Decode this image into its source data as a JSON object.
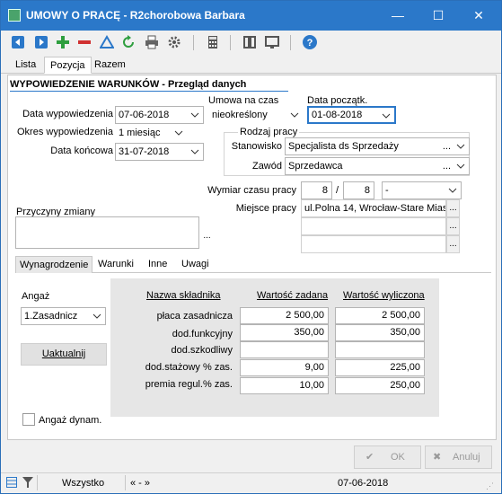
{
  "window": {
    "title": "UMOWY O PRACĘ - R2chorobowa Barbara"
  },
  "titlebar": {
    "minimize": "—",
    "maximize": "☐",
    "close": "✕"
  },
  "toolbar": {
    "icons": [
      "arrow-left-icon",
      "arrow-right-icon",
      "add-icon",
      "remove-icon",
      "filter-icon",
      "refresh-icon",
      "print-icon",
      "settings-icon",
      "calculator-icon",
      "columns-icon",
      "monitor-icon",
      "help-icon"
    ]
  },
  "tabs": [
    {
      "label": "Lista"
    },
    {
      "label": "Pozycja"
    },
    {
      "label": "Razem"
    }
  ],
  "section_title": "WYPOWIEDZENIE WARUNKÓW - Przegląd danych",
  "form": {
    "data_wypowiedzenia_label": "Data wypowiedzenia",
    "data_wypowiedzenia": "07-06-2018",
    "okres_label": "Okres wypowiedzenia",
    "okres": "1 miesiąc",
    "data_koncowa_label": "Data końcowa",
    "data_koncowa": "31-07-2018",
    "umowa_label": "Umowa na czas",
    "umowa": "nieokreślony",
    "data_poczatk_label": "Data początk.",
    "data_poczatk": "01-08-2018",
    "rodzaj_label": "Rodzaj pracy",
    "stanowisko_label": "Stanowisko",
    "stanowisko": "Specjalista ds Sprzedaży",
    "stanowisko_dots": "...",
    "zawod_label": "Zawód",
    "zawod": "Sprzedawca",
    "zawod_dots": "...",
    "wymiar_label": "Wymiar czasu pracy",
    "wymiar_a": "8",
    "wymiar_sep": "/",
    "wymiar_b": "8",
    "wymiar_c": "-",
    "miejsce_label": "Miejsce pracy",
    "miejsce_1": "ul.Polna 14,  Wrocław-Stare Mias",
    "miejsce_2": "",
    "miejsce_3": "",
    "przyczyny_label": "Przyczyny zmiany",
    "przyczyny": "",
    "dots": "..."
  },
  "bottom_tabs": [
    {
      "label": "Wynagrodzenie"
    },
    {
      "label": "Warunki"
    },
    {
      "label": "Inne"
    },
    {
      "label": "Uwagi"
    }
  ],
  "wyn": {
    "angaz_label": "Angaż",
    "angaz_value": "1.Zasadnicz",
    "uaktualnij": "Uaktualnij",
    "angaz_dynam": "Angaż dynam.",
    "headers": {
      "nazwa": "Nazwa składnika",
      "zadana": "Wartość zadana",
      "wyliczona": "Wartość wyliczona"
    },
    "rows": [
      {
        "name": "płaca zasadnicza",
        "zadana": "2 500,00",
        "wyliczona": "2 500,00"
      },
      {
        "name": "dod.funkcyjny",
        "zadana": "350,00",
        "wyliczona": "350,00"
      },
      {
        "name": "dod.szkodliwy",
        "zadana": "",
        "wyliczona": ""
      },
      {
        "name": "dod.stażowy % zas.",
        "zadana": "9,00",
        "wyliczona": "225,00"
      },
      {
        "name": "premia regul.% zas.",
        "zadana": "10,00",
        "wyliczona": "250,00"
      }
    ]
  },
  "buttons": {
    "ok": "OK",
    "cancel": "Anuluj"
  },
  "status": {
    "filter": "Wszystko",
    "nav": "« - »",
    "date": "07-06-2018"
  },
  "colors": {
    "accent": "#2b78c9",
    "add": "#2e9e3e",
    "remove": "#d03030"
  }
}
